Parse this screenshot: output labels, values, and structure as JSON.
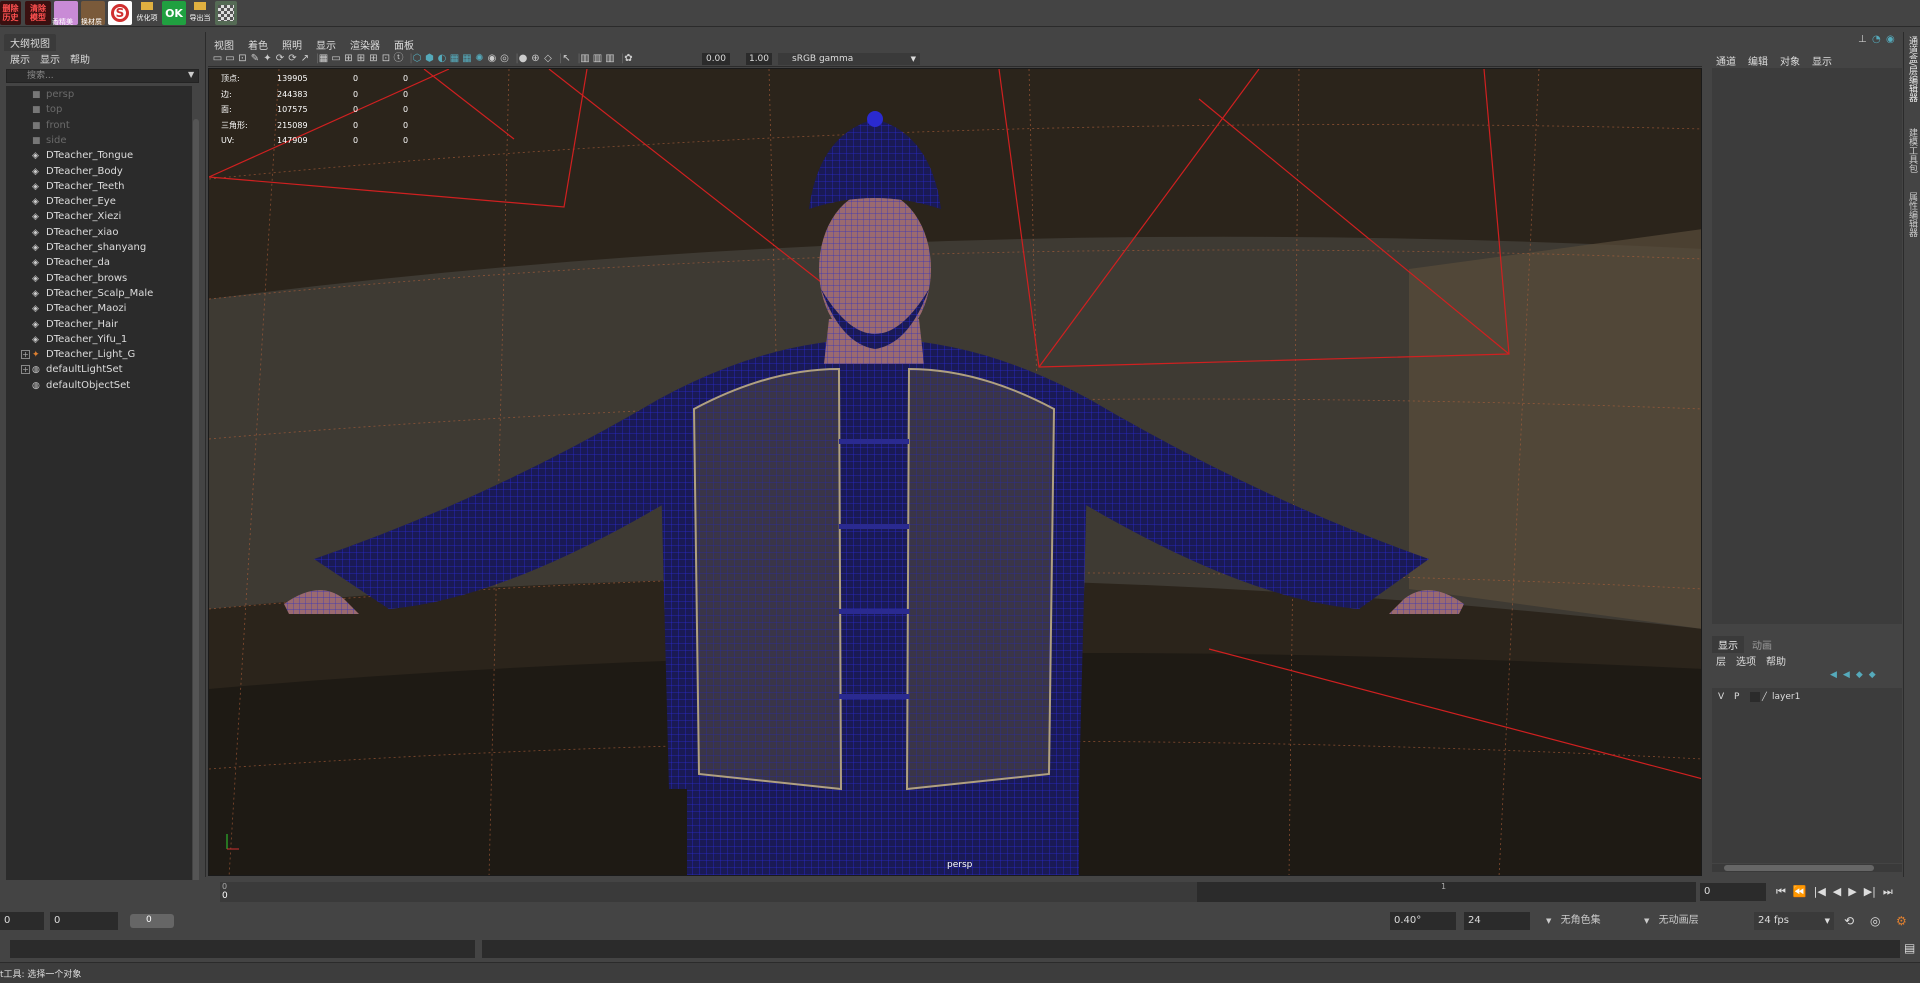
{
  "shelf": {
    "buttons": [
      {
        "label": "删除\n历史",
        "color": "#3a1010"
      },
      {
        "label": "清除\n模型",
        "color": "#3a1010"
      },
      {
        "label": "",
        "color": "#c98bd6"
      },
      {
        "label": "",
        "color": "#7a5a3a"
      },
      {
        "label": "",
        "color": "#d03030"
      },
      {
        "label": "优化项",
        "color": "#444444"
      },
      {
        "label": "OK",
        "color": "#20a040"
      },
      {
        "label": "导出当",
        "color": "#444444"
      },
      {
        "label": "",
        "color": "#556b55"
      }
    ],
    "sub_labels": [
      "香精美",
      "换材质"
    ]
  },
  "outliner": {
    "tab": "大纲视图",
    "menu": [
      "展示",
      "显示",
      "帮助"
    ],
    "search_placeholder": "搜索...",
    "items": [
      {
        "label": "persp",
        "type": "camera"
      },
      {
        "label": "top",
        "type": "camera"
      },
      {
        "label": "front",
        "type": "camera"
      },
      {
        "label": "side",
        "type": "camera"
      },
      {
        "label": "DTeacher_Tongue",
        "type": "mesh"
      },
      {
        "label": "DTeacher_Body",
        "type": "mesh"
      },
      {
        "label": "DTeacher_Teeth",
        "type": "mesh"
      },
      {
        "label": "DTeacher_Eye",
        "type": "mesh"
      },
      {
        "label": "DTeacher_Xiezi",
        "type": "mesh"
      },
      {
        "label": "DTeacher_xiao",
        "type": "mesh"
      },
      {
        "label": "DTeacher_shanyang",
        "type": "mesh"
      },
      {
        "label": "DTeacher_da",
        "type": "mesh"
      },
      {
        "label": "DTeacher_brows",
        "type": "mesh"
      },
      {
        "label": "DTeacher_Scalp_Male",
        "type": "mesh"
      },
      {
        "label": "DTeacher_Maozi",
        "type": "mesh"
      },
      {
        "label": "DTeacher_Hair",
        "type": "mesh"
      },
      {
        "label": "DTeacher_Yifu_1",
        "type": "mesh"
      },
      {
        "label": "DTeacher_Light_G",
        "type": "group"
      },
      {
        "label": "defaultLightSet",
        "type": "set"
      },
      {
        "label": "defaultObjectSet",
        "type": "set"
      }
    ]
  },
  "viewport": {
    "menu": [
      "视图",
      "着色",
      "照明",
      "显示",
      "渲染器",
      "面板"
    ],
    "exposure": "0.00",
    "gamma": "1.00",
    "color_space": "sRGB gamma",
    "camera_label": "persp",
    "hud": [
      {
        "k": "顶点:",
        "v": "139905",
        "a": "0",
        "b": "0"
      },
      {
        "k": "边:",
        "v": "244383",
        "a": "0",
        "b": "0"
      },
      {
        "k": "面:",
        "v": "107575",
        "a": "0",
        "b": "0"
      },
      {
        "k": "三角形:",
        "v": "215089",
        "a": "0",
        "b": "0"
      },
      {
        "k": "UV:",
        "v": "147909",
        "a": "0",
        "b": "0"
      }
    ]
  },
  "channelbox": {
    "menu": [
      "通道",
      "编辑",
      "对象",
      "显示"
    ]
  },
  "right_strip": [
    "通道盒/层编辑器",
    "建模工具包",
    "属性编辑器"
  ],
  "layers": {
    "tabs": [
      "显示",
      "动画"
    ],
    "menu": [
      "层",
      "选项",
      "帮助"
    ],
    "items": [
      {
        "v": "V",
        "p": "P",
        "name": "layer1"
      }
    ]
  },
  "timeline": {
    "start_tick": "0",
    "mid_tick": "1",
    "current_frame": "0",
    "ruler_marker": "0"
  },
  "range": {
    "start": "0",
    "inner": "0",
    "slider_val": "0",
    "fov": "0.40°",
    "end": "24",
    "char_set": "无角色集",
    "anim_layer": "无动画层",
    "fps": "24 fps"
  },
  "help": {
    "text": "t工具: 选择一个对象"
  }
}
